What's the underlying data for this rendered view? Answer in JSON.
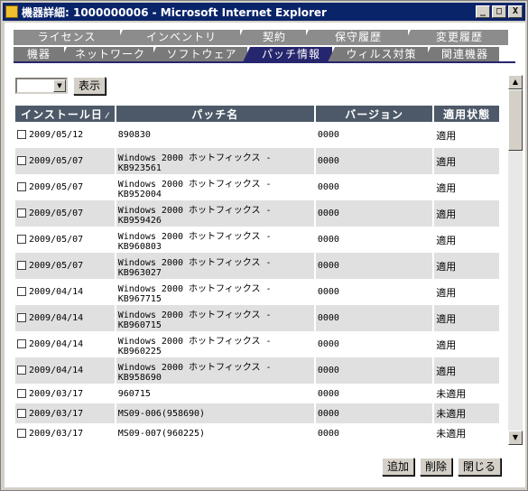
{
  "window": {
    "title": "機器詳細: 1000000006 - Microsoft Internet Explorer",
    "minimize": "_",
    "maximize": "□",
    "close": "X"
  },
  "tabs_back": [
    "ライセンス",
    "インベントリ",
    "契約",
    "保守履歴",
    "変更履歴"
  ],
  "tabs_front": [
    "機器",
    "ネットワーク",
    "ソフトウェア",
    "パッチ情報",
    "ウィルス対策",
    "関連機器"
  ],
  "active_tab": "パッチ情報",
  "filter": {
    "select_value": "",
    "show_button": "表示"
  },
  "table": {
    "headers": [
      "インストール日",
      "パッチ名",
      "バージョン",
      "適用状態"
    ],
    "rows": [
      {
        "date": "2009/05/12",
        "name": "890830",
        "version": "0000",
        "status": "適用"
      },
      {
        "date": "2009/05/07",
        "name": "Windows 2000 ホットフィックス - KB923561",
        "version": "0000",
        "status": "適用"
      },
      {
        "date": "2009/05/07",
        "name": "Windows 2000 ホットフィックス - KB952004",
        "version": "0000",
        "status": "適用"
      },
      {
        "date": "2009/05/07",
        "name": "Windows 2000 ホットフィックス - KB959426",
        "version": "0000",
        "status": "適用"
      },
      {
        "date": "2009/05/07",
        "name": "Windows 2000 ホットフィックス - KB960803",
        "version": "0000",
        "status": "適用"
      },
      {
        "date": "2009/05/07",
        "name": "Windows 2000 ホットフィックス - KB963027",
        "version": "0000",
        "status": "適用"
      },
      {
        "date": "2009/04/14",
        "name": "Windows 2000 ホットフィックス - KB967715",
        "version": "0000",
        "status": "適用"
      },
      {
        "date": "2009/04/14",
        "name": "Windows 2000 ホットフィックス - KB960715",
        "version": "0000",
        "status": "適用"
      },
      {
        "date": "2009/04/14",
        "name": "Windows 2000 ホットフィックス - KB960225",
        "version": "0000",
        "status": "適用"
      },
      {
        "date": "2009/04/14",
        "name": "Windows 2000 ホットフィックス - KB958690",
        "version": "0000",
        "status": "適用"
      },
      {
        "date": "2009/03/17",
        "name": "960715",
        "version": "0000",
        "status": "未適用"
      },
      {
        "date": "2009/03/17",
        "name": "MS09-006(958690)",
        "version": "0000",
        "status": "未適用"
      },
      {
        "date": "2009/03/17",
        "name": "MS09-007(960225)",
        "version": "0000",
        "status": "未適用"
      }
    ]
  },
  "footer": {
    "add": "追加",
    "delete": "削除",
    "close": "閉じる"
  },
  "colors": {
    "title_bar": "#0a246a",
    "active_tab": "#26266e",
    "table_header": "#4d5968"
  }
}
